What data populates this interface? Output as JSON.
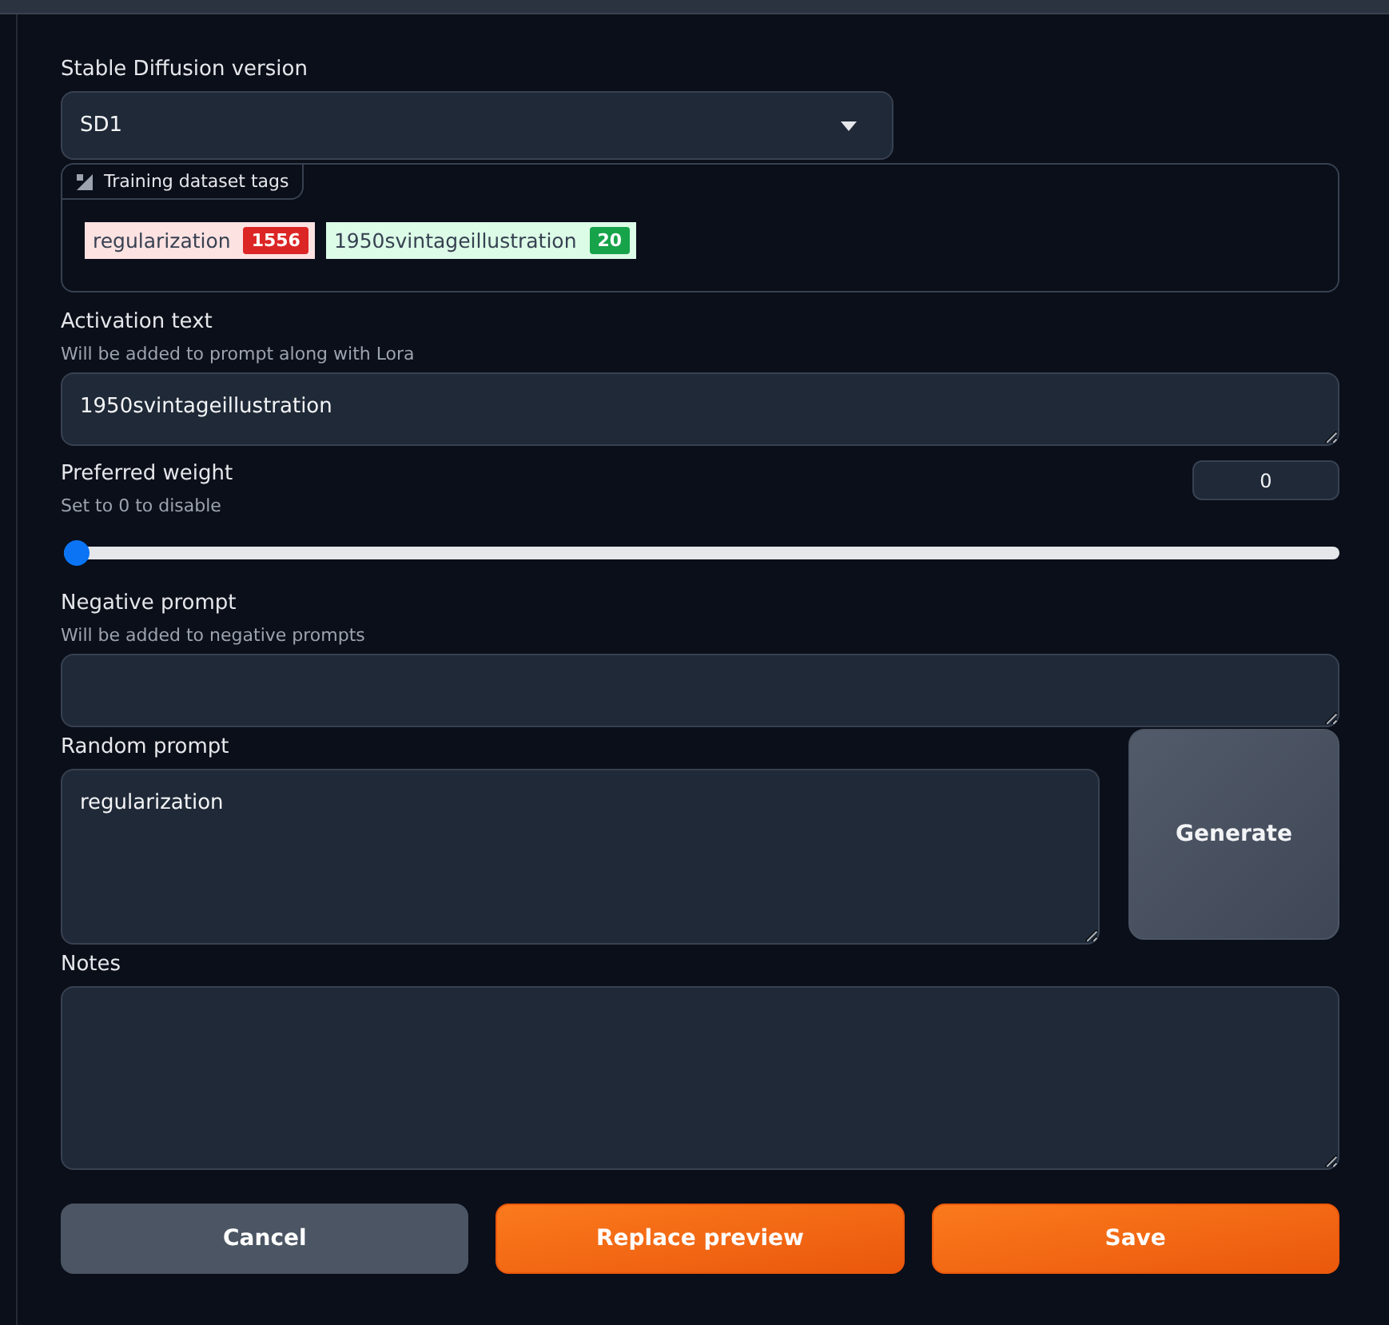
{
  "version": {
    "label": "Stable Diffusion version",
    "value": "SD1"
  },
  "dataset_tags": {
    "label": "Training dataset tags",
    "tags": [
      {
        "name": "regularization",
        "count": "1556",
        "color": "#dc2626"
      },
      {
        "name": "1950svintageillustration",
        "count": "20",
        "color": "#16a34a"
      }
    ]
  },
  "activation_text": {
    "label": "Activation text",
    "hint": "Will be added to prompt along with Lora",
    "value": "1950svintageillustration"
  },
  "preferred_weight": {
    "label": "Preferred weight",
    "hint": "Set to 0 to disable",
    "value": "0",
    "level": 0
  },
  "negative_prompt": {
    "label": "Negative prompt",
    "hint": "Will be added to negative prompts"
  },
  "random_prompt": {
    "label": "Random prompt",
    "value": "regularization",
    "button": "Generate"
  },
  "notes": {
    "label": "Notes"
  },
  "buttons": [
    {
      "label": "Cancel",
      "kind": "secondary"
    },
    {
      "label": "Replace preview",
      "kind": "primary"
    },
    {
      "label": "Save",
      "kind": "primary"
    }
  ]
}
